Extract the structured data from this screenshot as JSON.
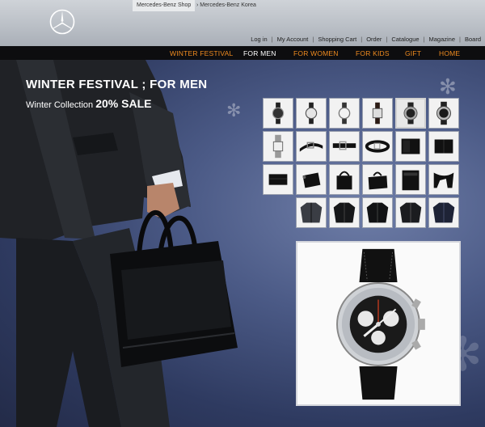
{
  "header": {
    "tabs": [
      {
        "label": "Mercedes-Benz Shop",
        "active": true
      },
      {
        "label": "› Mercedes-Benz Korea",
        "active": false
      }
    ],
    "utility_links": [
      "Log in",
      "My Account",
      "Shopping Cart",
      "Order",
      "Catalogue",
      "Magazine",
      "Board"
    ]
  },
  "nav": {
    "items": [
      {
        "label": "WINTER FESTIVAL",
        "color": "#f08b1f"
      },
      {
        "label": "FOR MEN",
        "color": "#ffffff"
      },
      {
        "label": "FOR WOMEN",
        "color": "#f08b1f"
      },
      {
        "label": "FOR KIDS",
        "color": "#f08b1f"
      },
      {
        "label": "GIFT",
        "color": "#f08b1f"
      },
      {
        "label": "HOME",
        "color": "#f08b1f"
      }
    ]
  },
  "hero": {
    "title": "WINTER FESTIVAL ; FOR MEN",
    "subtitle_prefix": "Winter Collection ",
    "subtitle_percent": "20%",
    "subtitle_suffix": " SALE"
  },
  "products": {
    "rows": [
      [
        "watch",
        "watch",
        "watch",
        "watch",
        "chronograph-watch",
        "chronograph-watch"
      ],
      [
        "bracelet-watch",
        "belt",
        "belt",
        "belt",
        "wallet",
        "wallet"
      ],
      [
        "card-holder",
        "pouch",
        "bag",
        "bag",
        "document-case",
        "scarf"
      ],
      [
        "jacket",
        "jacket",
        "jacket",
        "jacket",
        "jacket"
      ]
    ],
    "selected": "chronograph-watch"
  }
}
